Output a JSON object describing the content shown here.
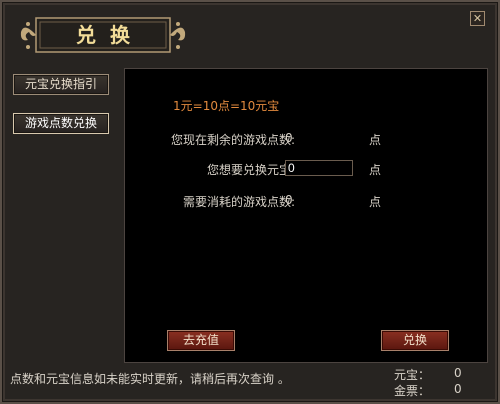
{
  "title": "兑换",
  "sidebar": {
    "items": [
      {
        "label": "元宝兑换指引"
      },
      {
        "label": "游戏点数兑换"
      }
    ]
  },
  "main": {
    "rate_text": "1元=10点=10元宝",
    "rows": [
      {
        "label": "您现在剩余的游戏点数:",
        "value": "0",
        "unit": "点"
      },
      {
        "label": "您想要兑换元宝:",
        "value": "0",
        "unit": "点"
      },
      {
        "label": "需要消耗的游戏点数:",
        "value": "0",
        "unit": "点"
      }
    ],
    "recharge_label": "去充值",
    "exchange_label": "兑换"
  },
  "footer": {
    "status": "点数和元宝信息如未能实时更新，请稍后再次查询 。",
    "balances": [
      {
        "label": "元宝：",
        "value": "0"
      },
      {
        "label": "金票：",
        "value": "0"
      }
    ]
  },
  "colors": {
    "rate": "#e28a3e",
    "title": "#f2dc98",
    "button_red": "#7a2218"
  },
  "icons": {
    "close": "close-icon"
  }
}
